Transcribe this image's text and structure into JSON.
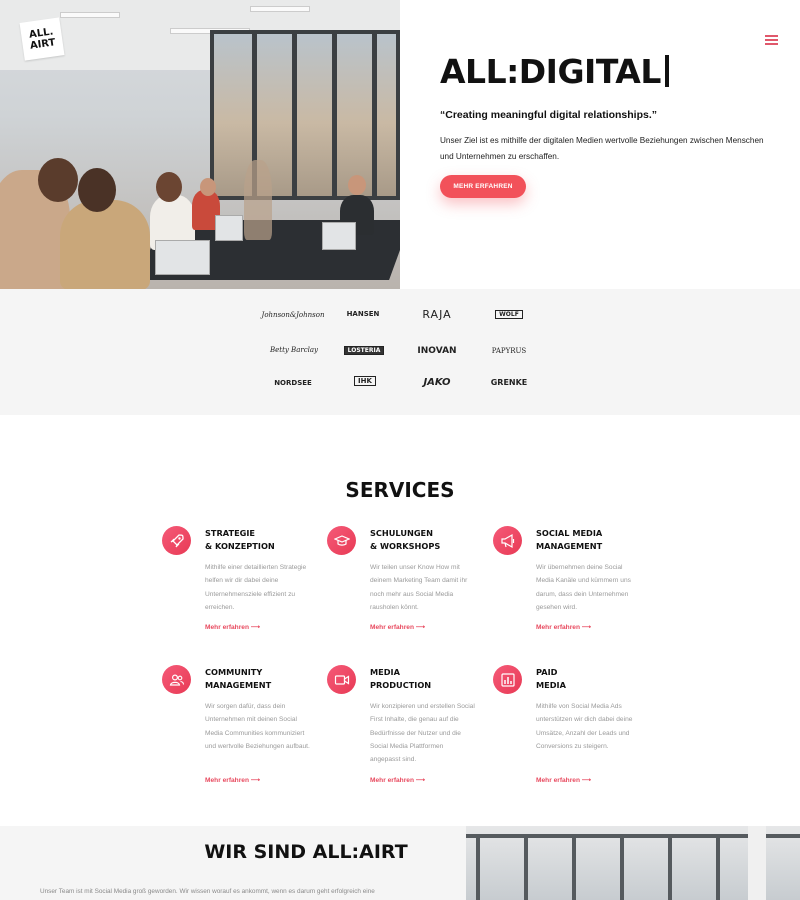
{
  "brand": {
    "logo_line1": "ALL.",
    "logo_line2": "AIRT",
    "accent": "#f2515a"
  },
  "hero": {
    "title": "ALL:DIGITAL",
    "quote": "“Creating meaningful digital relationships.”",
    "description": "Unser Ziel ist es mithilfe der digitalen Medien wertvolle Beziehungen zwischen Menschen und Unternehmen zu erschaffen.",
    "button_label": "MEHR ERFAHREN"
  },
  "menu": {
    "icon": "hamburger-menu-icon"
  },
  "clients": [
    "Johnson&Johnson",
    "HANSEN",
    "RAJA",
    "WOLF",
    "Betty Barclay",
    "LOSTERIA",
    "INOVAN",
    "PAPYRUS",
    "NORDSEE",
    "IHK",
    "JAKO",
    "GRENKE"
  ],
  "services": {
    "title": "SERVICES",
    "link_label": "Mehr erfahren ⟶",
    "items": [
      {
        "title": "STRATEGIE\n& KONZEPTION",
        "icon": "rocket-icon",
        "text": "Mithilfe einer detaillierten Strategie helfen wir dir dabei deine Unternehmensziele effizient zu erreichen."
      },
      {
        "title": "SCHULUNGEN\n& WORKSHOPS",
        "icon": "graduation-cap-icon",
        "text": "Wir teilen unser Know How mit deinem Marketing Team damit ihr noch mehr aus Social Media rausholen könnt."
      },
      {
        "title": "SOCIAL MEDIA\nMANAGEMENT",
        "icon": "megaphone-icon",
        "text": "Wir übernehmen deine Social Media Kanäle und kümmern uns darum, dass dein Unternehmen gesehen wird."
      },
      {
        "title": "COMMUNITY\nMANAGEMENT",
        "icon": "users-icon",
        "text": "Wir sorgen dafür, dass dein Unternehmen mit deinen Social Media Communities kommuniziert und wertvolle Beziehungen aufbaut."
      },
      {
        "title": "MEDIA\nPRODUCTION",
        "icon": "video-camera-icon",
        "text": "Wir konzipieren und erstellen Social First Inhalte, die genau auf die Bedürfnisse der Nutzer und die Social Media Plattformen angepasst sind."
      },
      {
        "title": "PAID\nMEDIA",
        "icon": "bar-chart-icon",
        "text": "Mithilfe von Social Media Ads unterstützen wir dich dabei deine Umsätze, Anzahl der Leads und Conversions zu steigern."
      }
    ]
  },
  "about": {
    "title": "WIR SIND ALL:AIRT",
    "text": "Unser Team ist mit Social Media groß geworden. Wir wissen worauf es ankommt, wenn es darum geht erfolgreich eine"
  }
}
